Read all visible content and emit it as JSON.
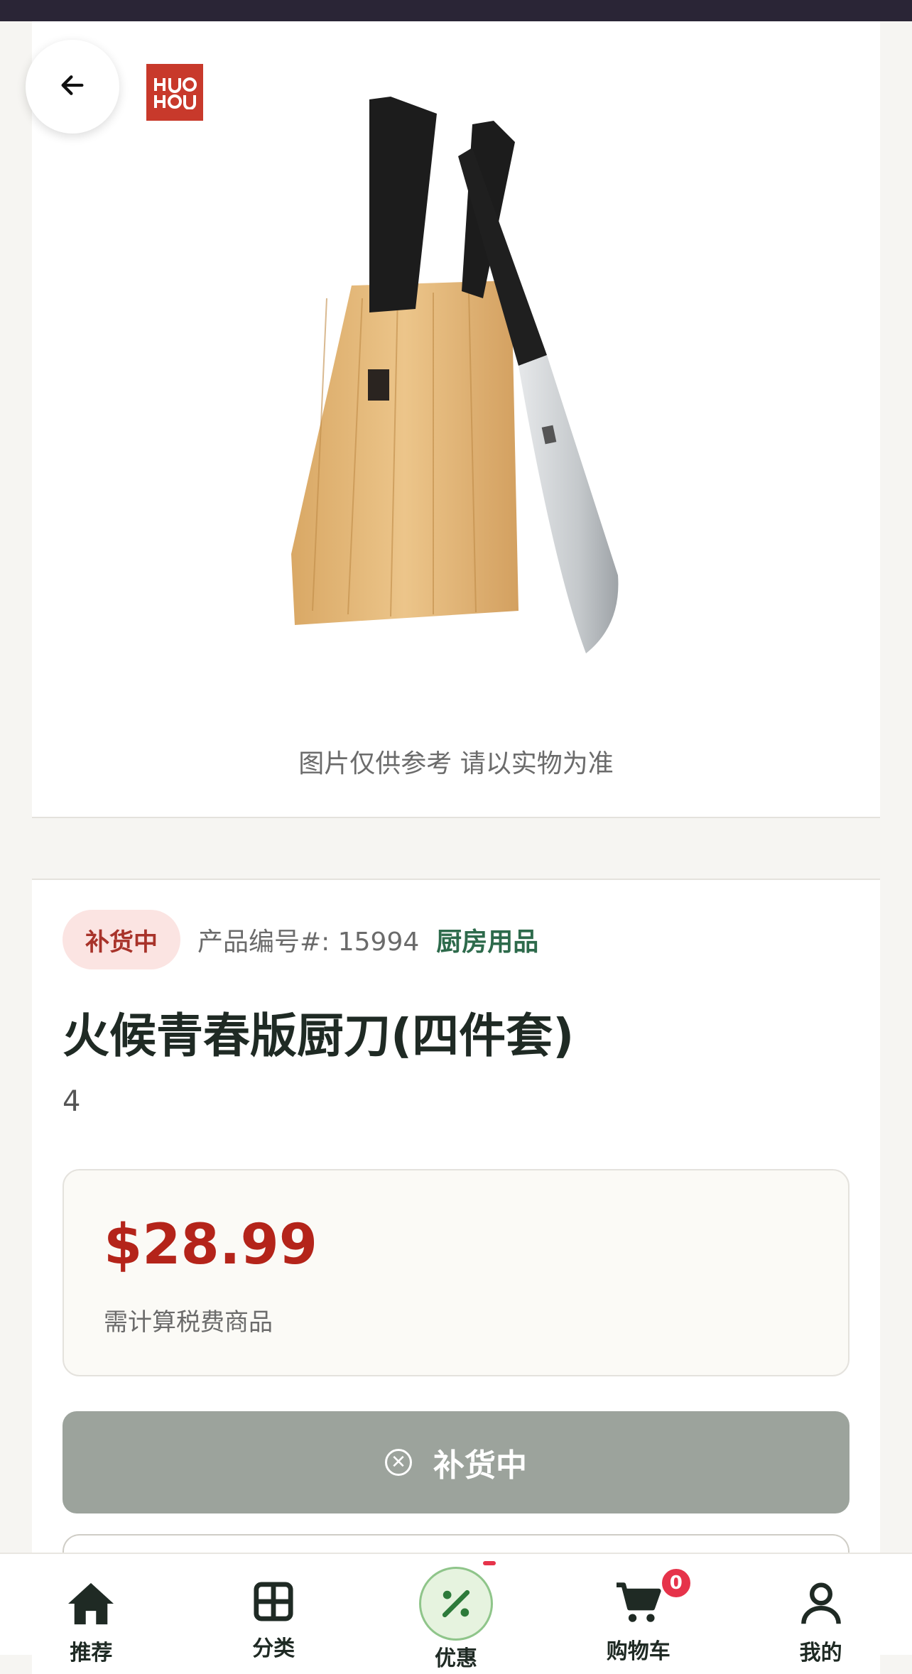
{
  "hero": {
    "image_note": "图片仅供参考 请以实物为准",
    "back_icon": "arrow-left-icon",
    "brand": "HUOHOU"
  },
  "product": {
    "stock_status": "补货中",
    "sku_label": "产品编号#: 15994",
    "category": "厨房用品",
    "title": "火候青春版厨刀(四件套)",
    "subtitle": "4",
    "price": "$28.99",
    "tax_note": "需计算税费商品",
    "cta_label": "补货中",
    "cta_icon": "close-circle-icon"
  },
  "tabbar": {
    "tabs": [
      {
        "label": "推荐",
        "icon": "home-icon"
      },
      {
        "label": "分类",
        "icon": "grid-icon"
      },
      {
        "label": "优惠",
        "icon": "percent-icon"
      },
      {
        "label": "购物车",
        "icon": "cart-icon",
        "badge": "0"
      },
      {
        "label": "我的",
        "icon": "user-icon"
      }
    ]
  },
  "colors": {
    "status_bar": "#2a2536",
    "price_red": "#b4241a",
    "category_green": "#2d6a4b",
    "cta_disabled": "#9ca39c",
    "badge_red": "#e6334a"
  }
}
